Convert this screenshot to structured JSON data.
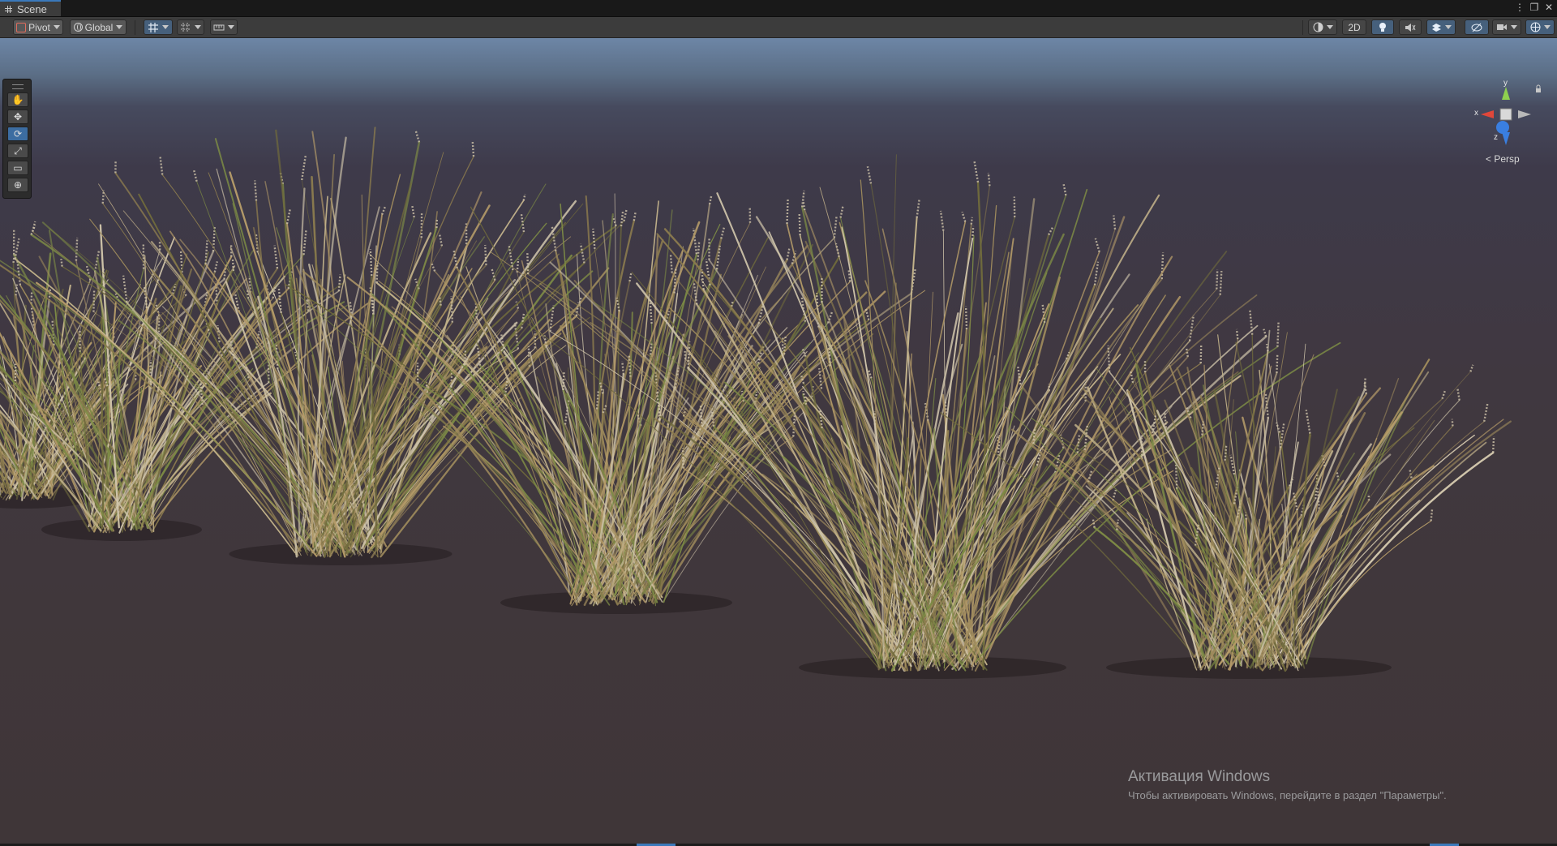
{
  "window": {
    "tab_title": "Scene",
    "controls": [
      "⋮",
      "❐",
      "✕"
    ]
  },
  "toolbar": {
    "pivot_label": "Pivot",
    "global_label": "Global",
    "mode_2d_label": "2D",
    "icons": [
      "edit-pivot-icon",
      "globe-icon",
      "grid-snap-icon",
      "increment-snap-icon",
      "ruler-icon",
      "shading-mode-icon",
      "lighting-icon",
      "audio-icon",
      "effects-icon",
      "hidden-objects-icon",
      "camera-icon",
      "gizmos-icon"
    ]
  },
  "tools": [
    {
      "name": "view-tool",
      "glyph": "✋",
      "active": false
    },
    {
      "name": "move-tool",
      "glyph": "✥",
      "active": false
    },
    {
      "name": "rotate-tool",
      "glyph": "⟳",
      "active": true
    },
    {
      "name": "scale-tool",
      "glyph": "⤢",
      "active": false
    },
    {
      "name": "rect-tool",
      "glyph": "▭",
      "active": false
    },
    {
      "name": "transform-tool",
      "glyph": "⊕",
      "active": false
    }
  ],
  "gizmo": {
    "axis_y": "y",
    "axis_x": "x",
    "axis_z": "z",
    "projection_label": "Persp",
    "colors": {
      "x": "#e0473a",
      "y": "#8fd14f",
      "z": "#3a7fe0"
    }
  },
  "watermark": {
    "title": "Активация Windows",
    "subtitle": "Чтобы активировать Windows, перейдите в раздел \"Параметры\"."
  },
  "colors": {
    "accent": "#3a79bb",
    "grass_dry": "#b39a68",
    "grass_pale": "#cfc4aa",
    "grass_green": "#7c8a45"
  }
}
